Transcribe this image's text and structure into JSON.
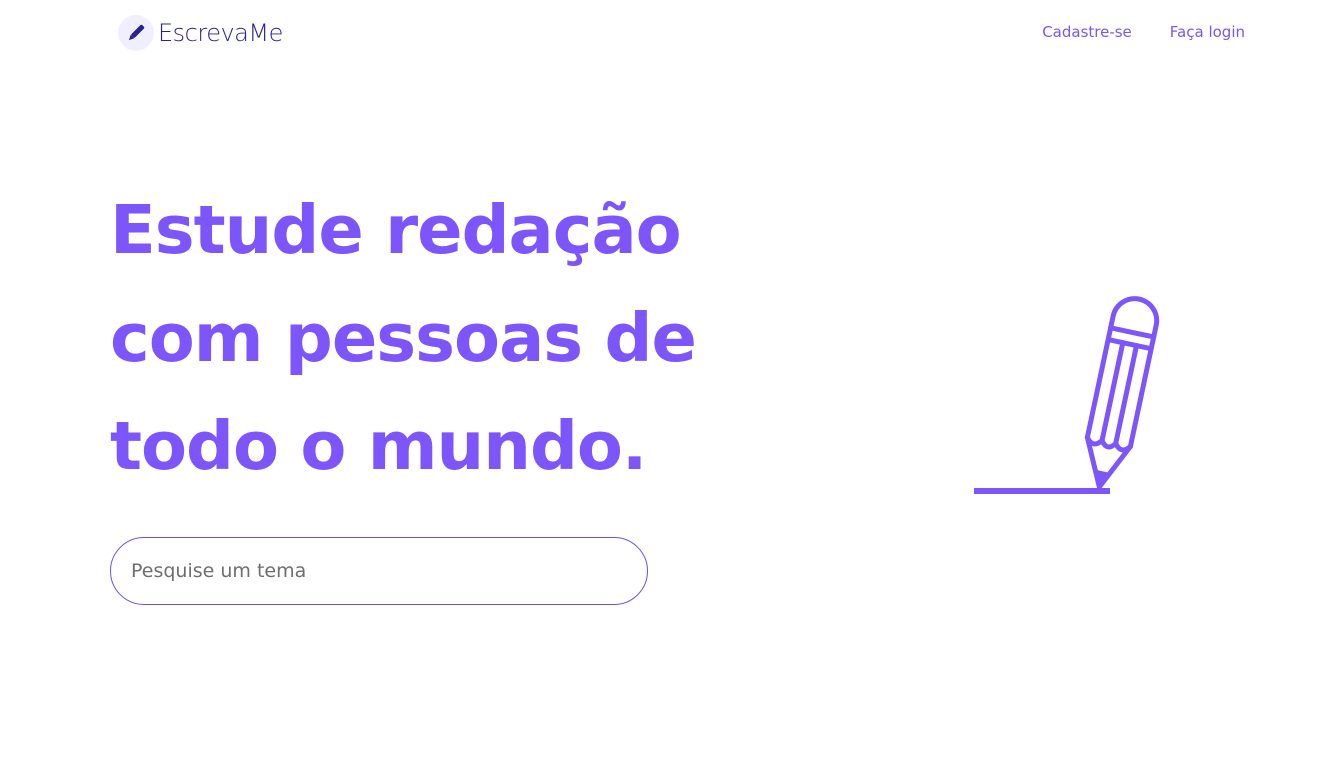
{
  "header": {
    "logo_text": "EscrevaMe",
    "logo_icon": "pencil-icon",
    "nav": {
      "signup_label": "Cadastre-se",
      "login_label": "Faça login"
    }
  },
  "hero": {
    "title_lines": [
      "Estude redação",
      "com pessoas de",
      "todo o mundo."
    ],
    "illustration_icon": "pencil-writing-icon"
  },
  "search": {
    "placeholder": "Pesquise um tema",
    "value": ""
  },
  "colors": {
    "accent": "#7c56fa",
    "logo_text": "#2c2190",
    "logo_mark_bg": "#f1efff",
    "search_border": "#6a4ef0"
  }
}
